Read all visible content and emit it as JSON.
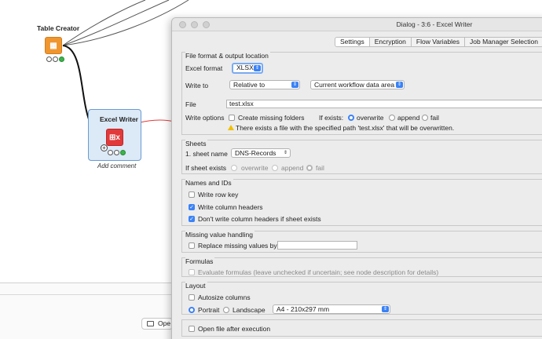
{
  "workflow": {
    "table_creator": {
      "title": "Table Creator"
    },
    "excel_writer": {
      "title": "Excel Writer",
      "comment": "Add comment"
    },
    "bottom_open_label": "Ope"
  },
  "dialog": {
    "title": "Dialog - 3:6 - Excel Writer",
    "tabs": [
      "Settings",
      "Encryption",
      "Flow Variables",
      "Job Manager Selection"
    ],
    "active_tab": "Settings",
    "file_format": {
      "title": "File format & output location",
      "excel_format_label": "Excel format",
      "excel_format_value": "XLSX",
      "write_to_label": "Write to",
      "write_to_value": "Relative to",
      "write_to_target": "Current workflow data area",
      "file_label": "File",
      "file_value": "test.xlsx",
      "write_options_label": "Write options",
      "create_missing_folders": "Create missing folders",
      "create_missing_folders_checked": false,
      "if_exists_label": "If exists:",
      "if_exists_options": [
        "overwrite",
        "append",
        "fail"
      ],
      "if_exists_selected": "overwrite",
      "warning": "There exists a file with the specified path 'test.xlsx' that will be overwritten."
    },
    "sheets": {
      "title": "Sheets",
      "sheet_name_label": "1. sheet name",
      "sheet_name_value": "DNS-Records",
      "if_sheet_exists_label": "If sheet exists",
      "if_sheet_exists_options": [
        "overwrite",
        "append",
        "fail"
      ],
      "if_sheet_exists_selected": "fail"
    },
    "names_ids": {
      "title": "Names and IDs",
      "write_row_key": "Write row key",
      "write_row_key_checked": false,
      "write_column_headers": "Write column headers",
      "write_column_headers_checked": true,
      "dont_write_headers": "Don't write column headers if sheet exists",
      "dont_write_headers_checked": true
    },
    "missing": {
      "title": "Missing value handling",
      "replace_label": "Replace missing values by",
      "replace_checked": false,
      "replace_value": ""
    },
    "formulas": {
      "title": "Formulas",
      "evaluate_label": "Evaluate formulas (leave unchecked if uncertain; see node description for details)",
      "evaluate_checked": false
    },
    "layout": {
      "title": "Layout",
      "autosize_label": "Autosize columns",
      "autosize_checked": false,
      "orientation_options": [
        "Portrait",
        "Landscape"
      ],
      "orientation_selected": "Portrait",
      "paper_size": "A4 - 210x297 mm"
    },
    "open_after": {
      "label": "Open file after execution",
      "checked": false
    }
  },
  "colors": {
    "accent": "#3b82f6",
    "node_source": "#f0962f",
    "node_sink": "#e23a3a",
    "connection_red": "#e23a3a",
    "warning": "#f0c000"
  }
}
